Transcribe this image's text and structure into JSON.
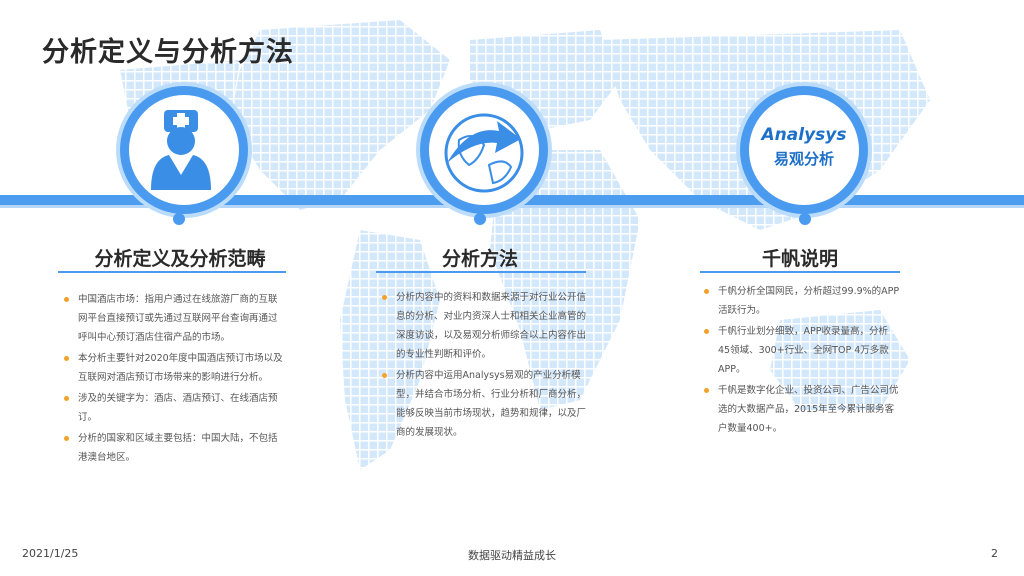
{
  "page": {
    "title": "分析定义与分析方法",
    "footer": {
      "date": "2021/1/25",
      "slogan": "数据驱动精益成长",
      "page_number": "2"
    }
  },
  "icons": {
    "section1": "nurse-icon",
    "section2": "globe-arrow-icon",
    "section3": "analysys-logo"
  },
  "logo": {
    "en": "Analysys",
    "cn": "易观分析"
  },
  "colors": {
    "accent": "#4a9bef",
    "bullet": "#f4a12a",
    "map": "#c9e2fb"
  },
  "sections": [
    {
      "title": "分析定义及分析范畴",
      "items": [
        "中国酒店市场：指用户通过在线旅游厂商的互联网平台直接预订或先通过互联网平台查询再通过呼叫中心预订酒店住宿产品的市场。",
        "本分析主要针对2020年度中国酒店预订市场以及互联网对酒店预订市场带来的影响进行分析。",
        "涉及的关键字为：酒店、酒店预订、在线酒店预订。",
        "分析的国家和区域主要包括：中国大陆，不包括港澳台地区。"
      ]
    },
    {
      "title": "分析方法",
      "items": [
        "分析内容中的资料和数据来源于对行业公开信息的分析、对业内资深人士和相关企业高管的深度访谈，以及易观分析师综合以上内容作出的专业性判断和评价。",
        "分析内容中运用Analysys易观的产业分析模型，并结合市场分析、行业分析和厂商分析，能够反映当前市场现状，趋势和规律，以及厂商的发展现状。"
      ]
    },
    {
      "title": "千帆说明",
      "items": [
        "千帆分析全国网民，分析超过99.9%的APP活跃行为。",
        "千帆行业划分细致，APP收录量高，分析45领域、300+行业、全网TOP 4万多款APP。",
        "千帆是数字化企业、投资公司、广告公司优选的大数据产品，2015年至今累计服务客户数量400+。"
      ]
    }
  ]
}
